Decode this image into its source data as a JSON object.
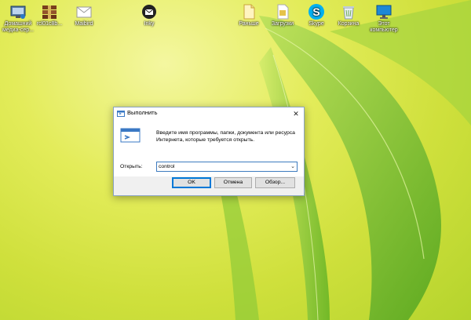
{
  "desktop": {
    "icons": [
      {
        "name": "home-media-server-icon",
        "label": "Домашний\nмедиа-сер..."
      },
      {
        "name": "archive-icon",
        "label": "rcl01c8b..."
      },
      {
        "name": "mail-icon",
        "label": "Maibird"
      },
      {
        "name": "inky-icon",
        "label": "Inky"
      },
      {
        "name": "folder-icon",
        "label": "Раньше"
      },
      {
        "name": "document-icon",
        "label": "Загрузки"
      },
      {
        "name": "skype-icon",
        "label": "Skype"
      },
      {
        "name": "recycle-bin-icon",
        "label": "Корзина"
      },
      {
        "name": "this-pc-icon",
        "label": "Этот\nкомпьютер"
      }
    ]
  },
  "run_dialog": {
    "title": "Выполнить",
    "close_glyph": "✕",
    "description": "Введите имя программы, папки, документа или ресурса Интернета, которые требуется открыть.",
    "open_label": "Открыть:",
    "input_value": "control",
    "dropdown_glyph": "⌄",
    "ok_label": "OK",
    "cancel_label": "Отмена",
    "browse_label": "Обзор..."
  },
  "colors": {
    "dialog_bg": "#f0f0f0",
    "accent": "#0078d7",
    "wallpaper_green": "#7cc22a"
  }
}
